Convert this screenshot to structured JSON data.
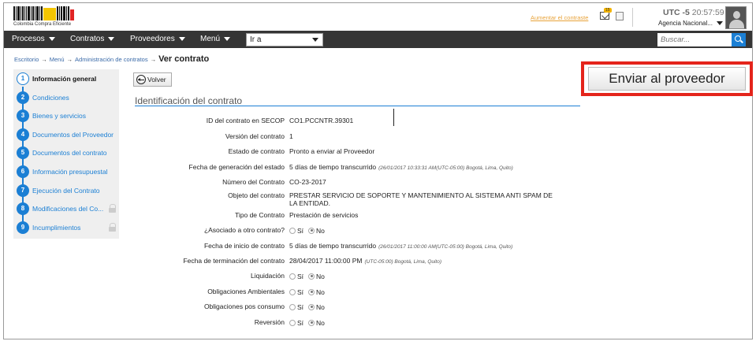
{
  "header": {
    "logo_label": "Colombia Compra Eficiente",
    "aumentar_link": "Aumentar el contraste",
    "mail_badge": "15",
    "utc_label": "UTC -5",
    "time": "20:57:59",
    "agency": "Agencia Nacional..."
  },
  "nav": {
    "items": [
      "Procesos",
      "Contratos",
      "Proveedores",
      "Menú"
    ],
    "goto_value": "Ir a",
    "search_placeholder": "Buscar..."
  },
  "breadcrumb": {
    "items": [
      "Escritorio",
      "Menú",
      "Administración de contratos"
    ],
    "current": "Ver contrato"
  },
  "send_button": "Enviar al proveedor",
  "sidebar": {
    "steps": [
      {
        "num": "1",
        "label": "Información general",
        "active": true,
        "locked": false
      },
      {
        "num": "2",
        "label": "Condiciones",
        "active": false,
        "locked": false
      },
      {
        "num": "3",
        "label": "Bienes y servicios",
        "active": false,
        "locked": false
      },
      {
        "num": "4",
        "label": "Documentos del Proveedor",
        "active": false,
        "locked": false
      },
      {
        "num": "5",
        "label": "Documentos del contrato",
        "active": false,
        "locked": false
      },
      {
        "num": "6",
        "label": "Información presupuestal",
        "active": false,
        "locked": false
      },
      {
        "num": "7",
        "label": "Ejecución del Contrato",
        "active": false,
        "locked": false
      },
      {
        "num": "8",
        "label": "Modificaciones del Co...",
        "active": false,
        "locked": true
      },
      {
        "num": "9",
        "label": "Incumplimientos",
        "active": false,
        "locked": true
      }
    ]
  },
  "main": {
    "back_button": "Volver",
    "section_title": "Identificación del contrato",
    "yes_label": "Sí",
    "no_label": "No",
    "fields": [
      {
        "key": "ID del contrato en SECOP",
        "value": "CO1.PCCNTR.39301",
        "sub": "",
        "radio": false
      },
      {
        "key": "Versión del contrato",
        "value": "1",
        "sub": "",
        "radio": false
      },
      {
        "key": "Estado de contrato",
        "value": "Pronto a enviar al Proveedor",
        "sub": "",
        "radio": false
      },
      {
        "key": "Fecha de generación del estado",
        "value": "5 días de tiempo transcurrido",
        "sub": "(26/01/2017 10:33:31 AM(UTC-05:00) Bogotá, Lima, Quito)",
        "radio": false
      },
      {
        "key": "Número del Contrato",
        "value": "CO-23-2017",
        "sub": "",
        "radio": false
      },
      {
        "key": "Objeto del contrato",
        "value": "PRESTAR SERVICIO DE SOPORTE Y MANTENIMIENTO AL SISTEMA ANTI SPAM DE LA ENTIDAD.",
        "sub": "",
        "radio": false
      },
      {
        "key": "Tipo de Contrato",
        "value": "Prestación de servicios",
        "sub": "",
        "radio": false
      },
      {
        "key": "¿Asociado a otro contrato?",
        "value": "",
        "sub": "",
        "radio": true
      },
      {
        "key": "Fecha de inicio de contrato",
        "value": "5 días de tiempo transcurrido",
        "sub": "(26/01/2017 11:00:00 AM(UTC-05:00) Bogotá, Lima, Quito)",
        "radio": false
      },
      {
        "key": "Fecha de terminación del contrato",
        "value": "28/04/2017 11:00:00 PM",
        "sub": "(UTC-05:00) Bogotá, Lima, Quito)",
        "radio": false
      },
      {
        "key": "Liquidación",
        "value": "",
        "sub": "",
        "radio": true
      },
      {
        "key": "Obligaciones Ambientales",
        "value": "",
        "sub": "",
        "radio": true
      },
      {
        "key": "Obligaciones pos consumo",
        "value": "",
        "sub": "",
        "radio": true
      },
      {
        "key": "Reversión",
        "value": "",
        "sub": "",
        "radio": true
      }
    ]
  }
}
